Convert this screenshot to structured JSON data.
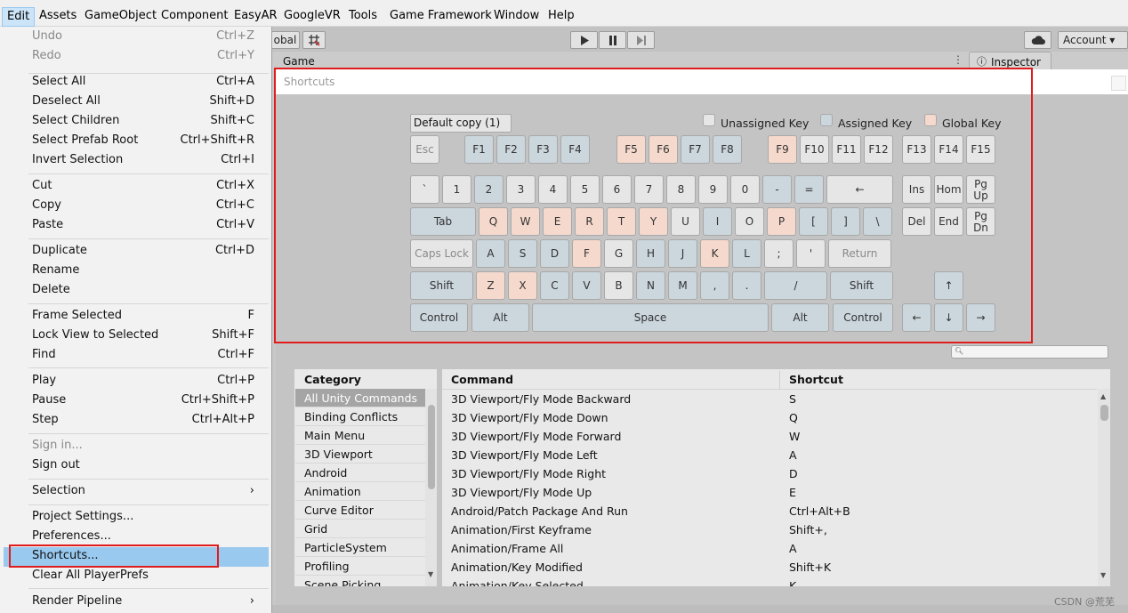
{
  "menubar": [
    "Edit",
    "Assets",
    "GameObject",
    "Component",
    "EasyAR",
    "GoogleVR",
    "Tools",
    "Game Framework",
    "Window",
    "Help"
  ],
  "toolbar": {
    "global": "obal",
    "account": "Account ▾"
  },
  "tabs": {
    "game": "Game",
    "inspector": "Inspector"
  },
  "edit_menu": [
    {
      "label": "Undo",
      "shortcut": "Ctrl+Z",
      "disabled": true
    },
    {
      "label": "Redo",
      "shortcut": "Ctrl+Y",
      "disabled": true
    },
    {
      "label": "Select All",
      "shortcut": "Ctrl+A"
    },
    {
      "label": "Deselect All",
      "shortcut": "Shift+D"
    },
    {
      "label": "Select Children",
      "shortcut": "Shift+C"
    },
    {
      "label": "Select Prefab Root",
      "shortcut": "Ctrl+Shift+R"
    },
    {
      "label": "Invert Selection",
      "shortcut": "Ctrl+I"
    },
    {
      "label": "Cut",
      "shortcut": "Ctrl+X"
    },
    {
      "label": "Copy",
      "shortcut": "Ctrl+C"
    },
    {
      "label": "Paste",
      "shortcut": "Ctrl+V"
    },
    {
      "label": "Duplicate",
      "shortcut": "Ctrl+D"
    },
    {
      "label": "Rename",
      "shortcut": ""
    },
    {
      "label": "Delete",
      "shortcut": ""
    },
    {
      "label": "Frame Selected",
      "shortcut": "F"
    },
    {
      "label": "Lock View to Selected",
      "shortcut": "Shift+F"
    },
    {
      "label": "Find",
      "shortcut": "Ctrl+F"
    },
    {
      "label": "Play",
      "shortcut": "Ctrl+P"
    },
    {
      "label": "Pause",
      "shortcut": "Ctrl+Shift+P"
    },
    {
      "label": "Step",
      "shortcut": "Ctrl+Alt+P"
    },
    {
      "label": "Sign in...",
      "shortcut": "",
      "disabled": true
    },
    {
      "label": "Sign out",
      "shortcut": ""
    },
    {
      "label": "Selection",
      "shortcut": "›"
    },
    {
      "label": "Project Settings...",
      "shortcut": ""
    },
    {
      "label": "Preferences...",
      "shortcut": ""
    },
    {
      "label": "Shortcuts...",
      "shortcut": "",
      "highlighted": true
    },
    {
      "label": "Clear All PlayerPrefs",
      "shortcut": ""
    },
    {
      "label": "Render Pipeline",
      "shortcut": "›"
    }
  ],
  "window": {
    "title": "Shortcuts",
    "profile": "Default copy (1)"
  },
  "legend": {
    "unassigned": "Unassigned Key",
    "assigned": "Assigned Key",
    "global": "Global Key"
  },
  "colors": {
    "unassigned": "#e6e6e6",
    "assigned": "#cbd6dd",
    "global": "#f6d9cd",
    "highlight_box": "#e01c1c",
    "menu_highlight": "#99c9ef"
  },
  "keyboard": {
    "row0": [
      {
        "t": "Esc",
        "s": "d"
      },
      {
        "t": "F1",
        "s": "a"
      },
      {
        "t": "F2",
        "s": "a"
      },
      {
        "t": "F3",
        "s": "a"
      },
      {
        "t": "F4",
        "s": "a"
      },
      {
        "t": "F5",
        "s": "g"
      },
      {
        "t": "F6",
        "s": "g"
      },
      {
        "t": "F7",
        "s": "a"
      },
      {
        "t": "F8",
        "s": "a"
      },
      {
        "t": "F9",
        "s": "g"
      },
      {
        "t": "F10",
        "s": "u"
      },
      {
        "t": "F11",
        "s": "u"
      },
      {
        "t": "F12",
        "s": "u"
      },
      {
        "t": "F13",
        "s": "u"
      },
      {
        "t": "F14",
        "s": "u"
      },
      {
        "t": "F15",
        "s": "u"
      }
    ],
    "row1": [
      {
        "t": "`",
        "s": "u"
      },
      {
        "t": "1",
        "s": "u"
      },
      {
        "t": "2",
        "s": "a"
      },
      {
        "t": "3",
        "s": "u"
      },
      {
        "t": "4",
        "s": "u"
      },
      {
        "t": "5",
        "s": "u"
      },
      {
        "t": "6",
        "s": "u"
      },
      {
        "t": "7",
        "s": "u"
      },
      {
        "t": "8",
        "s": "u"
      },
      {
        "t": "9",
        "s": "u"
      },
      {
        "t": "0",
        "s": "u"
      },
      {
        "t": "-",
        "s": "a"
      },
      {
        "t": "=",
        "s": "a"
      },
      {
        "t": "←",
        "s": "u"
      }
    ],
    "row1_nav": [
      {
        "t": "Ins",
        "s": "u"
      },
      {
        "t": "Hom",
        "s": "u"
      },
      {
        "t": "Pg Up",
        "s": "u"
      }
    ],
    "row2": [
      {
        "t": "Tab",
        "s": "a"
      },
      {
        "t": "Q",
        "s": "g"
      },
      {
        "t": "W",
        "s": "g"
      },
      {
        "t": "E",
        "s": "g"
      },
      {
        "t": "R",
        "s": "g"
      },
      {
        "t": "T",
        "s": "g"
      },
      {
        "t": "Y",
        "s": "g"
      },
      {
        "t": "U",
        "s": "u"
      },
      {
        "t": "I",
        "s": "a"
      },
      {
        "t": "O",
        "s": "u"
      },
      {
        "t": "P",
        "s": "g"
      },
      {
        "t": "[",
        "s": "a"
      },
      {
        "t": "]",
        "s": "a"
      },
      {
        "t": "\\",
        "s": "a"
      }
    ],
    "row2_nav": [
      {
        "t": "Del",
        "s": "u"
      },
      {
        "t": "End",
        "s": "u"
      },
      {
        "t": "Pg Dn",
        "s": "u"
      }
    ],
    "row3": [
      {
        "t": "Caps Lock",
        "s": "d"
      },
      {
        "t": "A",
        "s": "a"
      },
      {
        "t": "S",
        "s": "a"
      },
      {
        "t": "D",
        "s": "a"
      },
      {
        "t": "F",
        "s": "g"
      },
      {
        "t": "G",
        "s": "u"
      },
      {
        "t": "H",
        "s": "a"
      },
      {
        "t": "J",
        "s": "a"
      },
      {
        "t": "K",
        "s": "g"
      },
      {
        "t": "L",
        "s": "a"
      },
      {
        "t": ";",
        "s": "u"
      },
      {
        "t": "'",
        "s": "u"
      },
      {
        "t": "Return",
        "s": "d"
      }
    ],
    "row4": [
      {
        "t": "Shift",
        "s": "a"
      },
      {
        "t": "Z",
        "s": "g"
      },
      {
        "t": "X",
        "s": "g"
      },
      {
        "t": "C",
        "s": "a"
      },
      {
        "t": "V",
        "s": "a"
      },
      {
        "t": "B",
        "s": "u"
      },
      {
        "t": "N",
        "s": "a"
      },
      {
        "t": "M",
        "s": "a"
      },
      {
        "t": ",",
        "s": "a"
      },
      {
        "t": ".",
        "s": "a"
      },
      {
        "t": "/",
        "s": "a"
      },
      {
        "t": "Shift",
        "s": "a"
      }
    ],
    "row4_nav": [
      {
        "t": "↑",
        "s": "a"
      }
    ],
    "row5": [
      {
        "t": "Control",
        "s": "a"
      },
      {
        "t": "Alt",
        "s": "a"
      },
      {
        "t": "Space",
        "s": "a"
      },
      {
        "t": "Alt",
        "s": "a"
      },
      {
        "t": "Control",
        "s": "a"
      }
    ],
    "row5_nav": [
      {
        "t": "←",
        "s": "a"
      },
      {
        "t": "↓",
        "s": "a"
      },
      {
        "t": "→",
        "s": "a"
      }
    ]
  },
  "categories": {
    "header": "Category",
    "items": [
      "All Unity Commands",
      "Binding Conflicts",
      "Main Menu",
      "3D Viewport",
      "Android",
      "Animation",
      "Curve Editor",
      "Grid",
      "ParticleSystem",
      "Profiling",
      "Scene Picking"
    ],
    "selected": 0
  },
  "commands": {
    "header_command": "Command",
    "header_shortcut": "Shortcut",
    "rows": [
      [
        "3D Viewport/Fly Mode Backward",
        "S"
      ],
      [
        "3D Viewport/Fly Mode Down",
        "Q"
      ],
      [
        "3D Viewport/Fly Mode Forward",
        "W"
      ],
      [
        "3D Viewport/Fly Mode Left",
        "A"
      ],
      [
        "3D Viewport/Fly Mode Right",
        "D"
      ],
      [
        "3D Viewport/Fly Mode Up",
        "E"
      ],
      [
        "Android/Patch Package And Run",
        "Ctrl+Alt+B"
      ],
      [
        "Animation/First Keyframe",
        "Shift+,"
      ],
      [
        "Animation/Frame All",
        "A"
      ],
      [
        "Animation/Key Modified",
        "Shift+K"
      ],
      [
        "Animation/Key Selected",
        "K"
      ]
    ]
  },
  "watermark": "CSDN @荒芜"
}
